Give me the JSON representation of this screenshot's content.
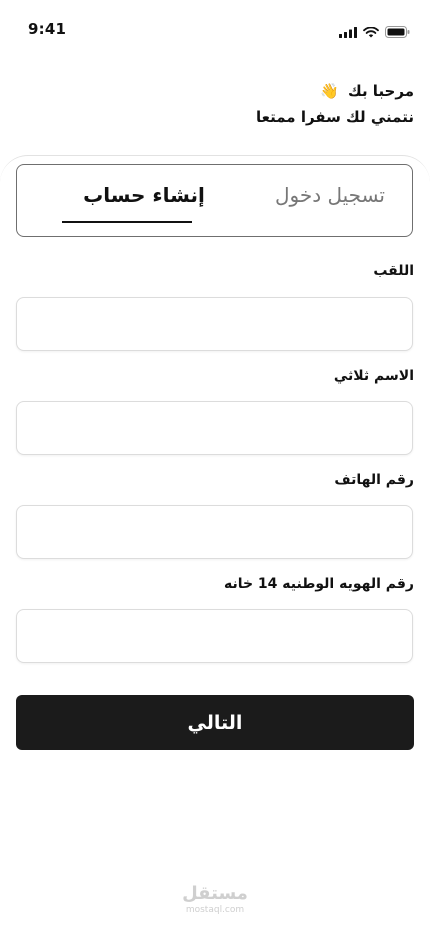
{
  "status_bar": {
    "time": "9:41"
  },
  "greeting": {
    "line1": "مرحبا بك",
    "emoji": "👋",
    "line2": "نتمني لك سفرا ممتعا"
  },
  "tabs": {
    "signup": "إنشاء حساب",
    "login": "تسجيل دخول",
    "active": "signup"
  },
  "form": {
    "fields": [
      {
        "label": "اللقب",
        "value": ""
      },
      {
        "label": "الاسم ثلاثي",
        "value": ""
      },
      {
        "label": "رقم الهاتف",
        "value": ""
      },
      {
        "label": "رقم الهويه الوطنيه 14 خانه",
        "value": ""
      }
    ],
    "next_label": "التالي"
  },
  "watermark": {
    "main": "مستقل",
    "sub": "mostaql.com"
  },
  "colors": {
    "primary": "#1b1b1b",
    "inactive_tab": "#777777",
    "input_border": "#dcdcdc"
  }
}
